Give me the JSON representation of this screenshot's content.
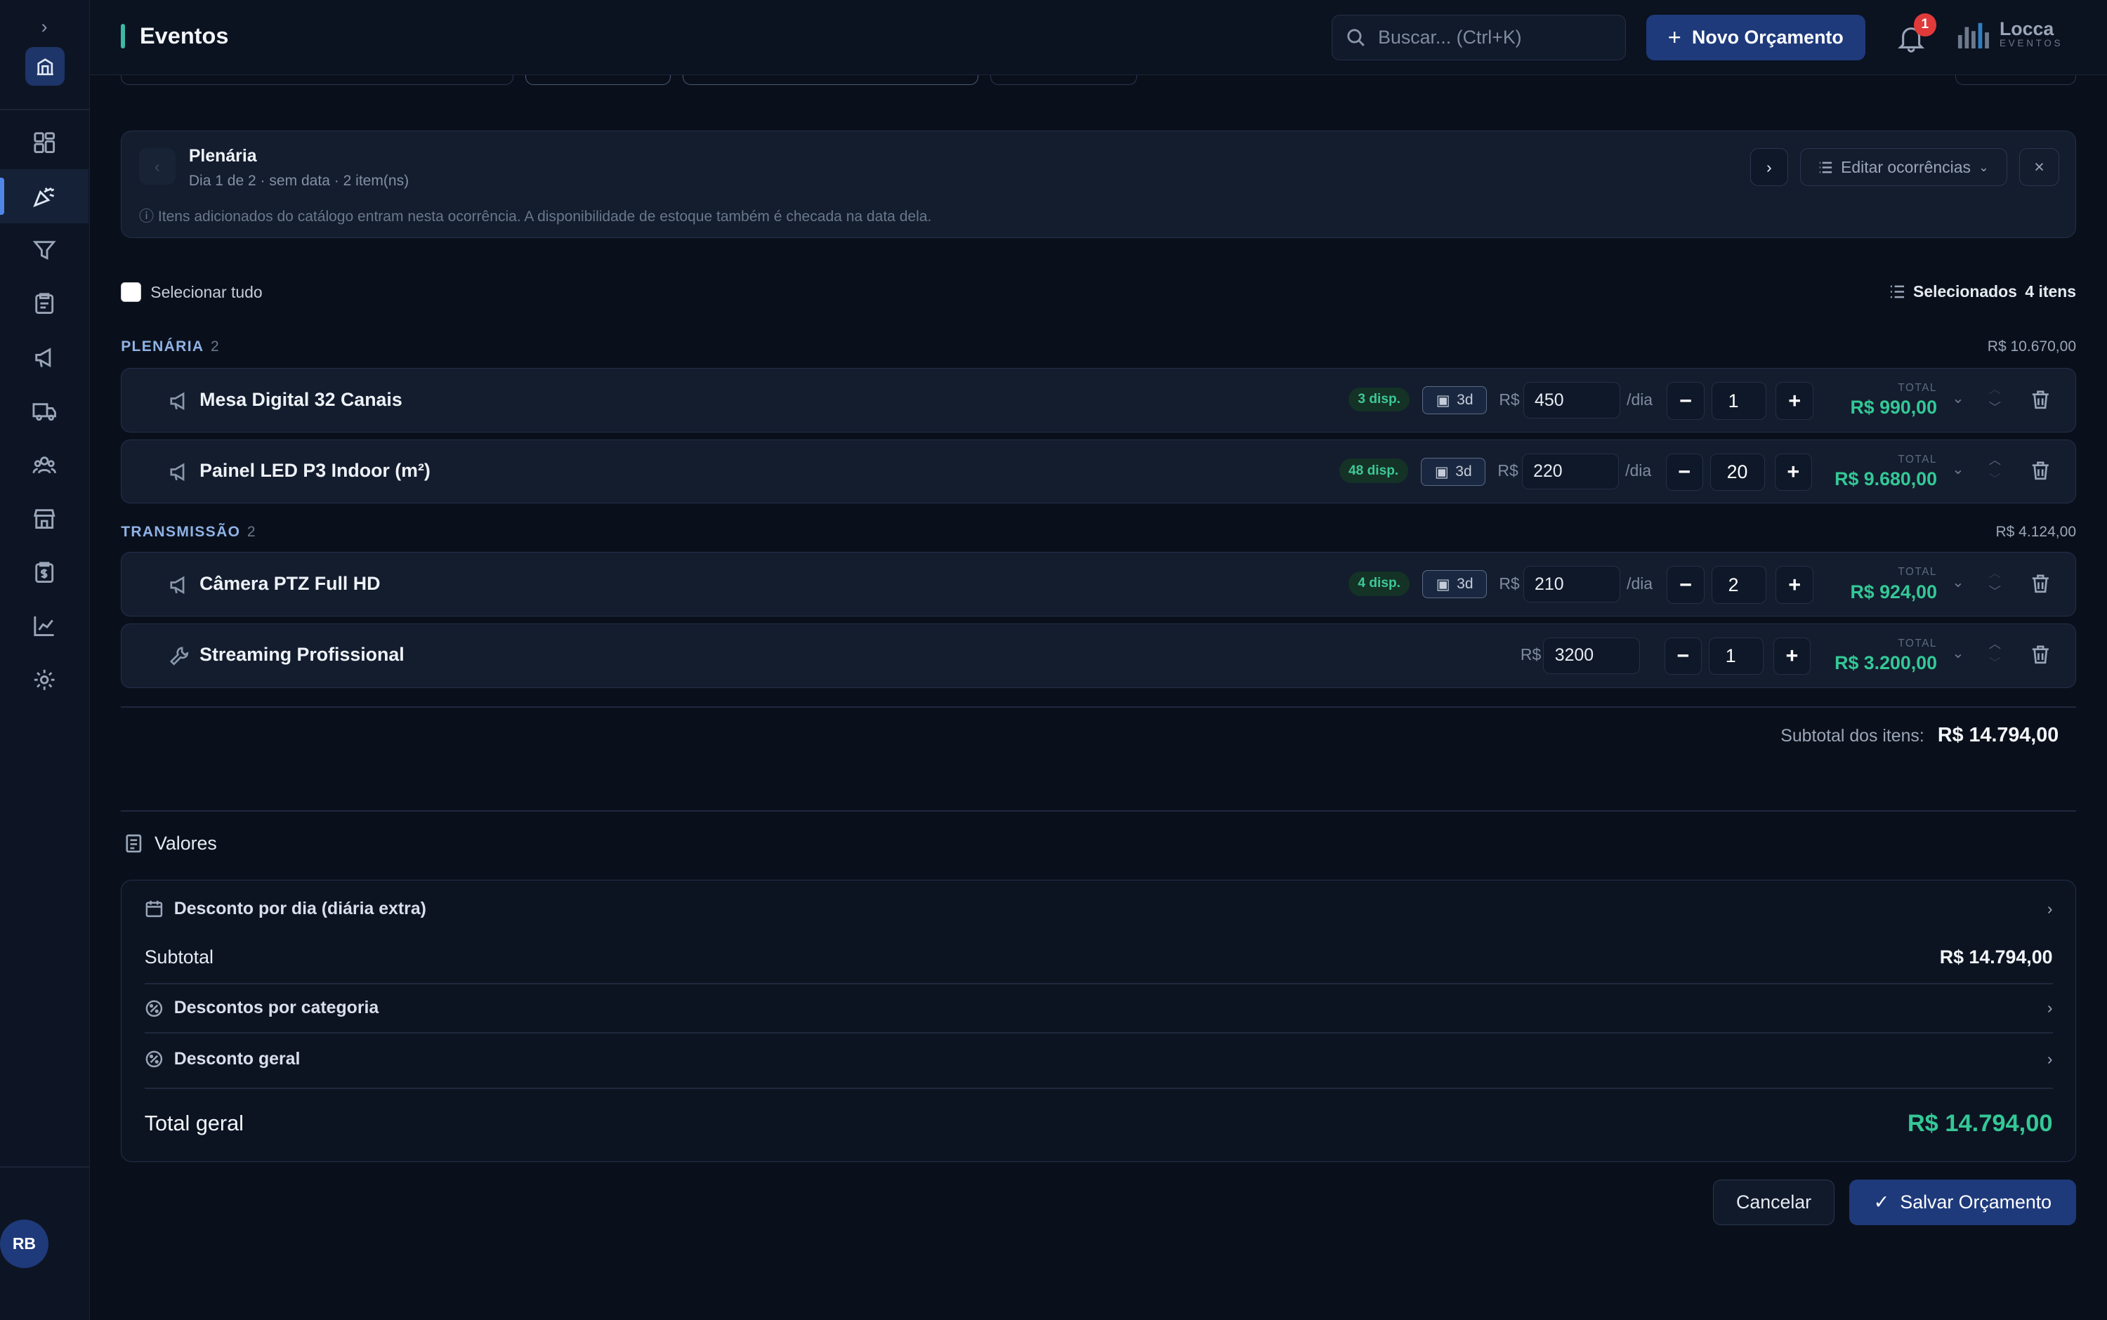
{
  "header": {
    "title": "Eventos",
    "search_placeholder": "Buscar... (Ctrl+K)",
    "new_button": "Novo Orçamento",
    "notification_count": "1",
    "brand_name": "Locca",
    "brand_sub": "EVENTOS"
  },
  "sidebar": {
    "toggle": "›",
    "avatar": "RB",
    "items": [
      "dashboard-icon",
      "party-icon",
      "funnel-icon",
      "clipboard-icon",
      "megaphone-icon",
      "truck-icon",
      "users-icon",
      "store-icon",
      "invoice-icon",
      "chart-icon",
      "gear-icon"
    ]
  },
  "occurrence": {
    "title": "Plenária",
    "subtitle": "Dia 1 de 2 · sem data · 2 item(ns)",
    "hint": "ⓘ Itens adicionados do catálogo entram nesta ocorrência. A disponibilidade de estoque também é checada na data dela.",
    "edit_label": "Editar ocorrências",
    "close": "×"
  },
  "selection": {
    "select_all": "Selecionar tudo",
    "selected_label": "Selecionados",
    "selected_count": "4 itens"
  },
  "categories": [
    {
      "name": "PLENÁRIA",
      "count": "2",
      "total": "R$ 10.670,00"
    },
    {
      "name": "TRANSMISSÃO",
      "count": "2",
      "total": "R$ 4.124,00"
    }
  ],
  "items": [
    {
      "name": "Mesa Digital 32 Canais",
      "disp": "3 disp.",
      "days": "3d",
      "currency": "R$",
      "price": "450",
      "unit": "/dia",
      "qty": "1",
      "total_label": "TOTAL",
      "total": "R$ 990,00"
    },
    {
      "name": "Painel LED P3 Indoor (m²)",
      "disp": "48 disp.",
      "days": "3d",
      "currency": "R$",
      "price": "220",
      "unit": "/dia",
      "qty": "20",
      "total_label": "TOTAL",
      "total": "R$ 9.680,00"
    },
    {
      "name": "Câmera PTZ Full HD",
      "disp": "4 disp.",
      "days": "3d",
      "currency": "R$",
      "price": "210",
      "unit": "/dia",
      "qty": "2",
      "total_label": "TOTAL",
      "total": "R$ 924,00"
    },
    {
      "name": "Streaming Profissional",
      "currency": "R$",
      "price": "3200",
      "qty": "1",
      "total_label": "TOTAL",
      "total": "R$ 3.200,00"
    }
  ],
  "subtotal_items": {
    "label": "Subtotal dos itens:",
    "value": "R$ 14.794,00"
  },
  "values": {
    "title": "Valores",
    "day_discount": "Desconto por dia (diária extra)",
    "subtotal_label": "Subtotal",
    "subtotal_value": "R$ 14.794,00",
    "category_discounts": "Descontos por categoria",
    "general_discount": "Desconto geral",
    "total_label": "Total geral",
    "total_value": "R$ 14.794,00"
  },
  "footer": {
    "cancel": "Cancelar",
    "save": "Salvar Orçamento"
  },
  "colors": {
    "accent": "#1e3a7b",
    "success": "#34c896",
    "teal": "#3bb9a6",
    "badge": "#e03a3a"
  }
}
